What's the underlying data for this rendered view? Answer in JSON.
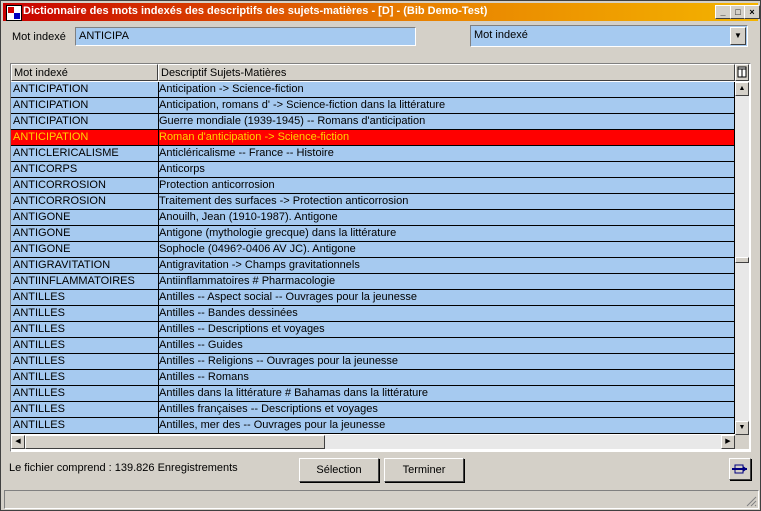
{
  "window": {
    "title": "Dictionnaire des mots indexés des descriptifs des sujets-matières - [D] - (Bib Demo-Test)",
    "min_glyph": "_",
    "max_glyph": "□",
    "close_glyph": "×"
  },
  "search": {
    "label": "Mot indexé",
    "value": "ANTICIPA",
    "mode_selected": "Mot indexé"
  },
  "grid": {
    "columns": [
      "Mot indexé",
      "Descriptif Sujets-Matières"
    ],
    "selected_index": 3,
    "rows": [
      [
        "ANTICIPATION",
        "Anticipation -> Science-fiction"
      ],
      [
        "ANTICIPATION",
        "Anticipation, romans d' -> Science-fiction dans la littérature"
      ],
      [
        "ANTICIPATION",
        "Guerre mondiale (1939-1945) -- Romans d'anticipation"
      ],
      [
        "ANTICIPATION",
        "Roman d'anticipation -> Science-fiction"
      ],
      [
        "ANTICLERICALISME",
        "Anticléricalisme -- France -- Histoire"
      ],
      [
        "ANTICORPS",
        "Anticorps"
      ],
      [
        "ANTICORROSION",
        "Protection anticorrosion"
      ],
      [
        "ANTICORROSION",
        "Traitement des surfaces -> Protection anticorrosion"
      ],
      [
        "ANTIGONE",
        "Anouilh, Jean (1910-1987). Antigone"
      ],
      [
        "ANTIGONE",
        "Antigone (mythologie grecque) dans la littérature"
      ],
      [
        "ANTIGONE",
        "Sophocle (0496?-0406 AV JC). Antigone"
      ],
      [
        "ANTIGRAVITATION",
        "Antigravitation -> Champs gravitationnels"
      ],
      [
        "ANTIINFLAMMATOIRES",
        "Antiinflammatoires # Pharmacologie"
      ],
      [
        "ANTILLES",
        "Antilles -- Aspect social -- Ouvrages pour la jeunesse"
      ],
      [
        "ANTILLES",
        "Antilles -- Bandes dessinées"
      ],
      [
        "ANTILLES",
        "Antilles -- Descriptions et voyages"
      ],
      [
        "ANTILLES",
        "Antilles -- Guides"
      ],
      [
        "ANTILLES",
        "Antilles -- Religions -- Ouvrages pour la jeunesse"
      ],
      [
        "ANTILLES",
        "Antilles -- Romans"
      ],
      [
        "ANTILLES",
        "Antilles dans la littérature # Bahamas dans la littérature"
      ],
      [
        "ANTILLES",
        "Antilles françaises -- Descriptions et voyages"
      ],
      [
        "ANTILLES",
        "Antilles, mer des -- Ouvrages pour la jeunesse"
      ]
    ]
  },
  "footer": {
    "record_count": "Le fichier comprend : 139.826 Enregistrements",
    "selection_label": "Sélection",
    "close_label": "Terminer"
  },
  "icons": {
    "column_chooser": "column-chooser-icon",
    "export": "export-icon"
  },
  "colors": {
    "row_bg": "#a6caf0",
    "selected_bg": "#ff0000",
    "selected_fg": "#ffd400",
    "title_start": "#c80000",
    "title_end": "#f4b400"
  }
}
